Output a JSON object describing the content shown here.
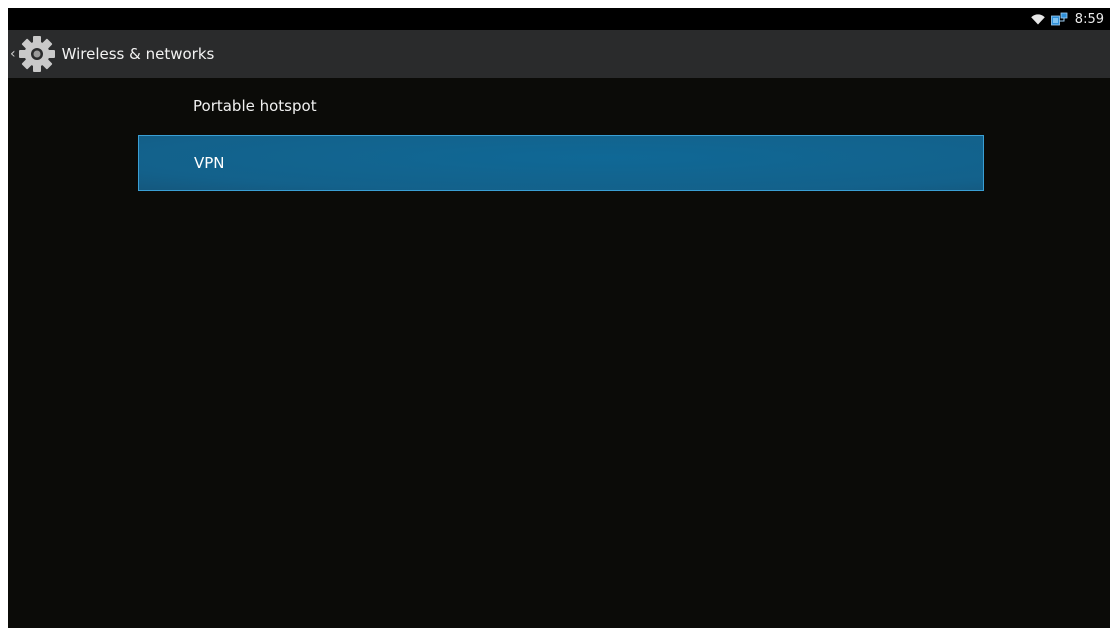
{
  "status_bar": {
    "time": "8:59",
    "icons": [
      "wifi-icon",
      "ethernet-icon"
    ]
  },
  "action_bar": {
    "title": "Wireless & networks",
    "icon": "settings-gear-icon",
    "up_icon": "chevron-left-icon"
  },
  "list": {
    "items": [
      {
        "label": "Portable hotspot",
        "selected": false
      },
      {
        "label": "VPN",
        "selected": true
      }
    ]
  },
  "colors": {
    "background": "#0b0b08",
    "action_bar": "#2a2b2c",
    "selected_item": "#13628c",
    "selected_border": "#3a9fd4",
    "text": "#f1f1f1"
  }
}
